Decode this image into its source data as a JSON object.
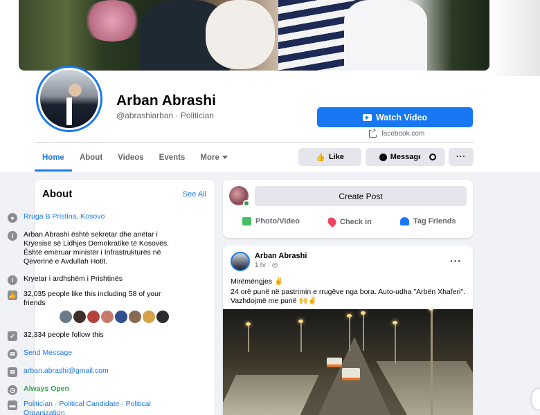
{
  "profile": {
    "name": "Arban Abrashi",
    "handle": "@abrashiarban · Politician"
  },
  "actions": {
    "watch_video": "Watch Video",
    "website": "facebook.com",
    "like": "Like",
    "message": "Message",
    "more_dots": "···"
  },
  "tabs": [
    "Home",
    "About",
    "Videos",
    "Events",
    "More"
  ],
  "about": {
    "title": "About",
    "see_all": "See All",
    "address": "Rruga B Pristina, Kosovo",
    "description": "Arban Abrashi është sekretar dhe anëtar i Kryesisë së Lidhjes Demokratike të Kosovës. Është emëruar ministër i Infrastrukturës në Qeverinë e Avdullah Hotit.",
    "position": "Kryetar i ardhshëm i Prishtinës",
    "likes": "32,035 people like this including 58 of your friends",
    "follows": "32,334 people follow this",
    "send_message": "Send Message",
    "email": "arban.abrashi@gmail.com",
    "hours": "Always Open",
    "categories": "Politician · Political Candidate · Political Organization"
  },
  "create_post": {
    "label": "Create Post",
    "photo_video": "Photo/Video",
    "check_in": "Check in",
    "tag_friends": "Tag Friends"
  },
  "post": {
    "author": "Arban Abrashi",
    "time": "1 hr · ",
    "menu": "···",
    "line1": "Mirëmëngjes ✌",
    "line2": "24 orë punë në pastrimin e rrugëve nga bora. Auto-udha \"Arbën Xhaferi\". Vazhdojmë me punë 🙌✌"
  },
  "colors": {
    "accent": "#1877f2",
    "background": "#f0f2f5",
    "secondary_text": "#65676b",
    "open_status": "#31a24c"
  },
  "icons": {
    "address": "location-pin-icon",
    "info": "info-icon",
    "like": "thumbs-up-icon",
    "follow": "follow-check-icon",
    "messenger": "messenger-icon",
    "email": "envelope-icon",
    "clock": "clock-icon",
    "category": "folder-icon",
    "search": "search-icon",
    "globe": "globe-icon",
    "external": "external-link-icon"
  }
}
